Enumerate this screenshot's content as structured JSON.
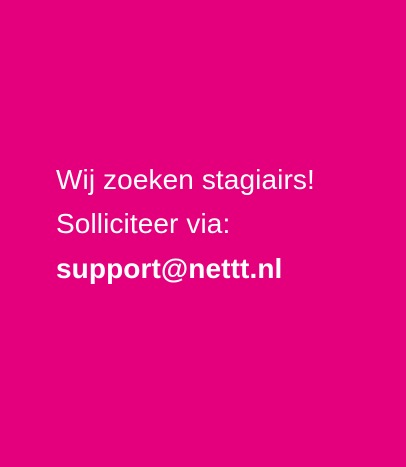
{
  "card": {
    "background_color": "#e4007c",
    "text_color": "#ffffff",
    "heading_line1": "Wij zoeken stagiairs!",
    "heading_line2": "Solliciteer via:",
    "email": "support@nettt.nl"
  }
}
